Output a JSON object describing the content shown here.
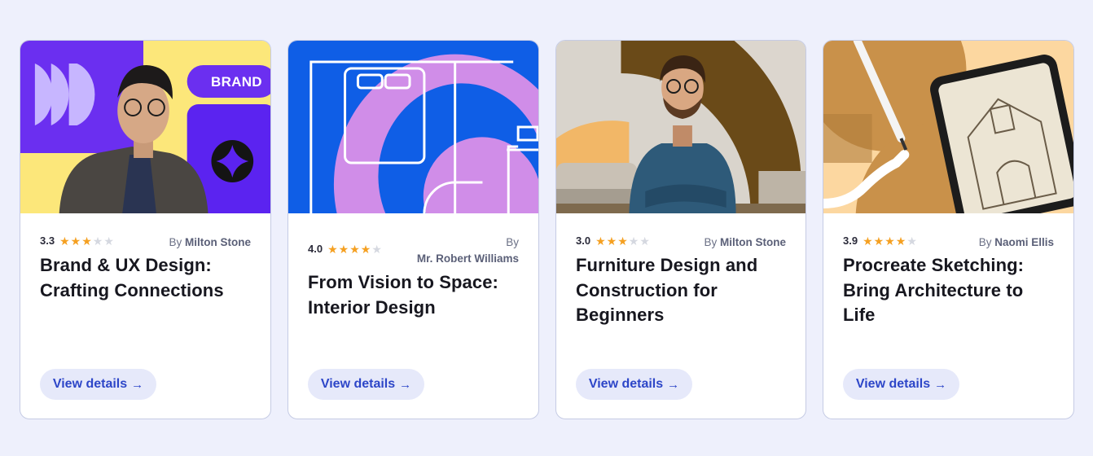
{
  "colors": {
    "page_bg": "#eef0fc",
    "star_on": "#f5a021",
    "star_off": "#d5d8e0",
    "button_bg": "#e6e9fa",
    "button_text": "#2d46c8"
  },
  "cards": [
    {
      "rating": "3.3",
      "stars_filled": 3,
      "author_prefix": "By",
      "author": "Milton Stone",
      "title": "Brand & UX Design: Crafting Connections",
      "button": "View details",
      "thumb_badge": "BRAND"
    },
    {
      "rating": "4.0",
      "stars_filled": 4,
      "author_prefix": "By",
      "author": "Mr. Robert Williams",
      "title": "From Vision to Space: Interior Design",
      "button": "View details"
    },
    {
      "rating": "3.0",
      "stars_filled": 3,
      "author_prefix": "By",
      "author": "Milton Stone",
      "title": "Furniture Design and Construction for Beginners",
      "button": "View details"
    },
    {
      "rating": "3.9",
      "stars_filled": 4,
      "author_prefix": "By",
      "author": "Naomi Ellis",
      "title": "Procreate Sketching: Bring Architecture to Life",
      "button": "View details"
    }
  ],
  "icons": {
    "star": "star-icon",
    "arrow": "arrow-right-icon"
  }
}
